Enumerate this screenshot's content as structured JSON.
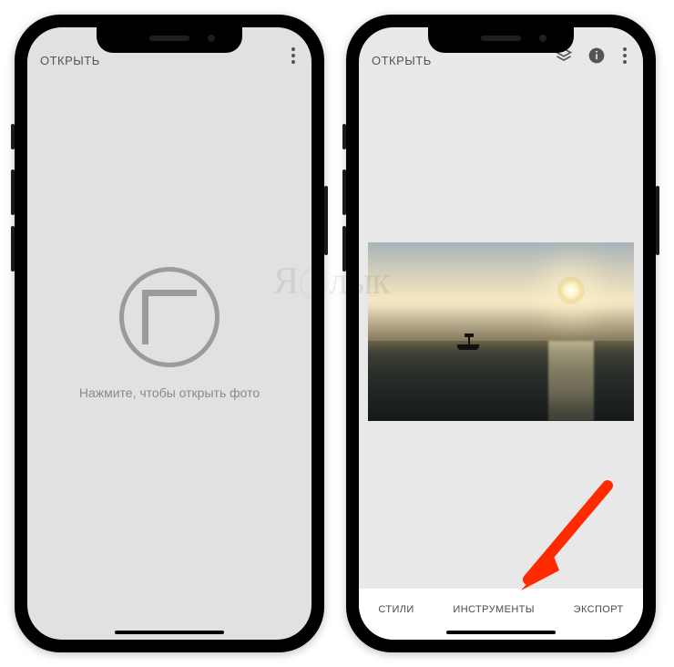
{
  "phone1": {
    "header": {
      "open_label": "ОТКРЫТЬ"
    },
    "empty": {
      "hint": "Нажмите, чтобы открыть фото"
    }
  },
  "phone2": {
    "header": {
      "open_label": "ОТКРЫТЬ"
    },
    "tabs": {
      "styles": "СТИЛИ",
      "tools": "ИНСТРУМЕНТЫ",
      "export": "ЭКСПОРТ"
    }
  },
  "icons": {
    "more": "more-vert-icon",
    "layers": "layers-icon",
    "info": "info-icon"
  },
  "watermark": {
    "text_left": "Я",
    "text_right": "лык"
  },
  "annotation": {
    "arrow_color": "#ff2a00"
  }
}
